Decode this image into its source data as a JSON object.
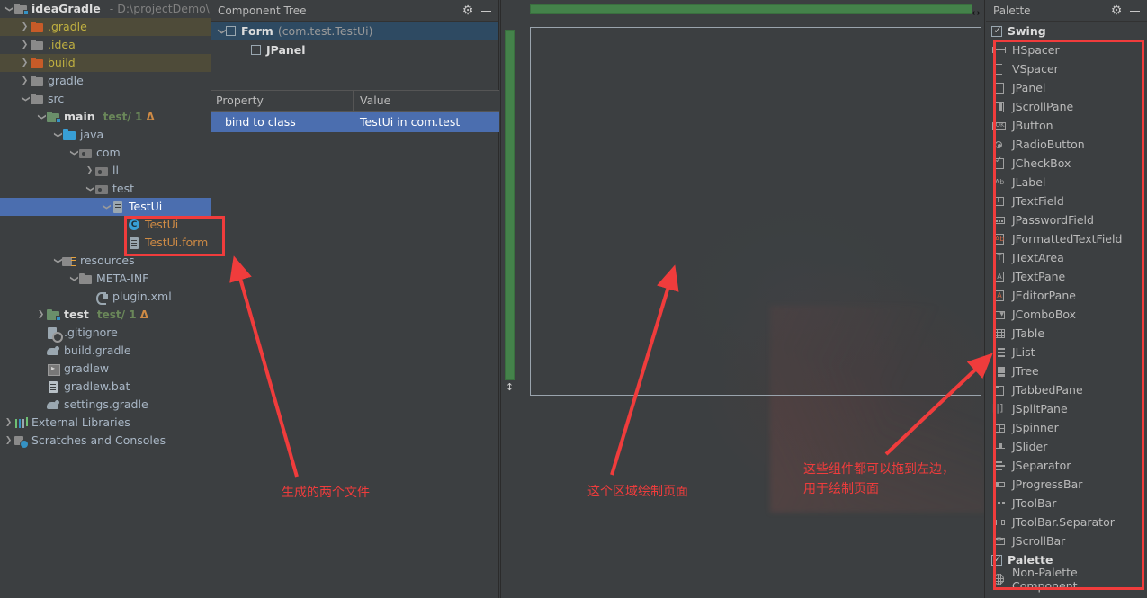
{
  "project_tree": {
    "nodes": [
      {
        "label": "ideaGradle",
        "path": "- D:\\projectDemo\\id",
        "icon": "folder-module-icon",
        "indent": 0,
        "arrow": "down",
        "style": "bold",
        "state": "normal"
      },
      {
        "label": ".gradle",
        "icon": "folder-orange-icon",
        "indent": 1,
        "arrow": "right",
        "style": "yellow",
        "state": "highlight"
      },
      {
        "label": ".idea",
        "icon": "folder-icon",
        "indent": 1,
        "arrow": "right",
        "style": "yellow",
        "state": "normal"
      },
      {
        "label": "build",
        "icon": "folder-orange-icon",
        "indent": 1,
        "arrow": "right",
        "style": "yellow",
        "state": "highlight"
      },
      {
        "label": "gradle",
        "icon": "folder-icon",
        "indent": 1,
        "arrow": "right",
        "style": "gray",
        "state": "normal"
      },
      {
        "label": "src",
        "icon": "folder-icon",
        "indent": 1,
        "arrow": "down",
        "style": "gray",
        "state": "normal"
      },
      {
        "label": "main",
        "sub": "test/ 1",
        "sub_warn": "Δ",
        "icon": "folder-src-icon",
        "indent": 2,
        "arrow": "down",
        "style": "bold",
        "state": "normal"
      },
      {
        "label": "java",
        "icon": "folder-blue-icon",
        "indent": 3,
        "arrow": "down",
        "style": "gray",
        "state": "normal"
      },
      {
        "label": "com",
        "icon": "package-icon",
        "indent": 4,
        "arrow": "down",
        "style": "gray",
        "state": "normal"
      },
      {
        "label": "ll",
        "icon": "package-icon",
        "indent": 5,
        "arrow": "right",
        "style": "gray",
        "state": "normal"
      },
      {
        "label": "test",
        "icon": "package-icon",
        "indent": 5,
        "arrow": "down",
        "style": "gray",
        "state": "normal"
      },
      {
        "label": "TestUi",
        "icon": "form-file-icon",
        "indent": 6,
        "arrow": "down",
        "style": "white",
        "state": "selected"
      },
      {
        "label": "TestUi",
        "icon": "java-class-icon",
        "indent": 7,
        "arrow": "none",
        "style": "orange",
        "state": "normal"
      },
      {
        "label": "TestUi.form",
        "icon": "form-file-icon",
        "indent": 7,
        "arrow": "none",
        "style": "orange",
        "state": "normal"
      },
      {
        "label": "resources",
        "icon": "resources-folder-icon",
        "indent": 3,
        "arrow": "down",
        "style": "gray",
        "state": "normal"
      },
      {
        "label": "META-INF",
        "icon": "folder-icon",
        "indent": 4,
        "arrow": "down",
        "style": "gray",
        "state": "normal"
      },
      {
        "label": "plugin.xml",
        "icon": "xml-file-icon",
        "indent": 5,
        "arrow": "none",
        "style": "gray",
        "state": "normal"
      },
      {
        "label": "test",
        "sub": "test/ 1",
        "sub_warn": "Δ",
        "icon": "folder-src-icon",
        "indent": 2,
        "arrow": "right",
        "style": "bold",
        "state": "normal"
      },
      {
        "label": ".gitignore",
        "icon": "gitignore-icon",
        "indent": 2,
        "arrow": "none",
        "style": "gray",
        "state": "normal"
      },
      {
        "label": "build.gradle",
        "icon": "gradle-icon",
        "indent": 2,
        "arrow": "none",
        "style": "gray",
        "state": "normal"
      },
      {
        "label": "gradlew",
        "icon": "script-icon",
        "indent": 2,
        "arrow": "none",
        "style": "gray",
        "state": "normal"
      },
      {
        "label": "gradlew.bat",
        "icon": "bat-file-icon",
        "indent": 2,
        "arrow": "none",
        "style": "gray",
        "state": "normal"
      },
      {
        "label": "settings.gradle",
        "icon": "gradle-icon",
        "indent": 2,
        "arrow": "none",
        "style": "gray",
        "state": "normal"
      },
      {
        "label": "External Libraries",
        "icon": "libraries-icon",
        "indent": 0,
        "arrow": "right",
        "style": "gray",
        "state": "normal"
      },
      {
        "label": "Scratches and Consoles",
        "icon": "scratches-icon",
        "indent": 0,
        "arrow": "right",
        "style": "gray",
        "state": "normal"
      }
    ]
  },
  "component_panel": {
    "title": "Component Tree",
    "gear_icon": "gear-icon",
    "minimize_icon": "minimize-icon",
    "tree": [
      {
        "name": "Form",
        "pkg": "(com.test.TestUi)",
        "indent": 0,
        "arrow": "down",
        "selected": true
      },
      {
        "name": "JPanel",
        "pkg": "",
        "indent": 1,
        "arrow": "none",
        "selected": false
      }
    ],
    "property_table": {
      "headers": [
        "Property",
        "Value"
      ],
      "rows": [
        {
          "property": "bind to class",
          "value": "TestUi in com.test",
          "selected": true
        }
      ]
    }
  },
  "designer": {
    "ruler_h_color": "#44824a",
    "ruler_v_color": "#44824a",
    "grab_h_icon": "horizontal-resize-icon",
    "grab_v_icon": "vertical-resize-icon"
  },
  "palette": {
    "title": "Palette",
    "gear_icon": "gear-icon",
    "minimize_icon": "minimize-icon",
    "groups": [
      {
        "label": "Swing",
        "checked": true
      },
      {
        "label": "Palette",
        "checked": true
      }
    ],
    "swing_items": [
      {
        "label": "HSpacer",
        "icon": "hspacer-icon"
      },
      {
        "label": "VSpacer",
        "icon": "vspacer-icon"
      },
      {
        "label": "JPanel",
        "icon": "jpanel-icon"
      },
      {
        "label": "JScrollPane",
        "icon": "jscrollpane-icon"
      },
      {
        "label": "JButton",
        "icon": "jbutton-icon"
      },
      {
        "label": "JRadioButton",
        "icon": "jradiobutton-icon"
      },
      {
        "label": "JCheckBox",
        "icon": "jcheckbox-icon"
      },
      {
        "label": "JLabel",
        "icon": "jlabel-icon"
      },
      {
        "label": "JTextField",
        "icon": "jtextfield-icon"
      },
      {
        "label": "JPasswordField",
        "icon": "jpasswordfield-icon"
      },
      {
        "label": "JFormattedTextField",
        "icon": "jformattedtextfield-icon"
      },
      {
        "label": "JTextArea",
        "icon": "jtextarea-icon"
      },
      {
        "label": "JTextPane",
        "icon": "jtextpane-icon"
      },
      {
        "label": "JEditorPane",
        "icon": "jeditorpane-icon"
      },
      {
        "label": "JComboBox",
        "icon": "jcombobox-icon"
      },
      {
        "label": "JTable",
        "icon": "jtable-icon"
      },
      {
        "label": "JList",
        "icon": "jlist-icon"
      },
      {
        "label": "JTree",
        "icon": "jtree-icon"
      },
      {
        "label": "JTabbedPane",
        "icon": "jtabbedpane-icon"
      },
      {
        "label": "JSplitPane",
        "icon": "jsplitpane-icon"
      },
      {
        "label": "JSpinner",
        "icon": "jspinner-icon"
      },
      {
        "label": "JSlider",
        "icon": "jslider-icon"
      },
      {
        "label": "JSeparator",
        "icon": "jseparator-icon"
      },
      {
        "label": "JProgressBar",
        "icon": "jprogressbar-icon"
      },
      {
        "label": "JToolBar",
        "icon": "jtoolbar-icon"
      },
      {
        "label": "JToolBar.Separator",
        "icon": "jtoolbar-separator-icon"
      },
      {
        "label": "JScrollBar",
        "icon": "jscrollbar-icon"
      }
    ],
    "palette_items": [
      {
        "label": "Non-Palette Component...",
        "icon": "non-palette-component-icon"
      }
    ]
  },
  "annotations": {
    "accent_color": "#f03c3c",
    "generated_files": "生成的两个文件",
    "canvas_area": "这个区域绘制页面",
    "palette_line1": "这些组件都可以拖到左边，",
    "palette_line2": "用于绘制页面"
  }
}
